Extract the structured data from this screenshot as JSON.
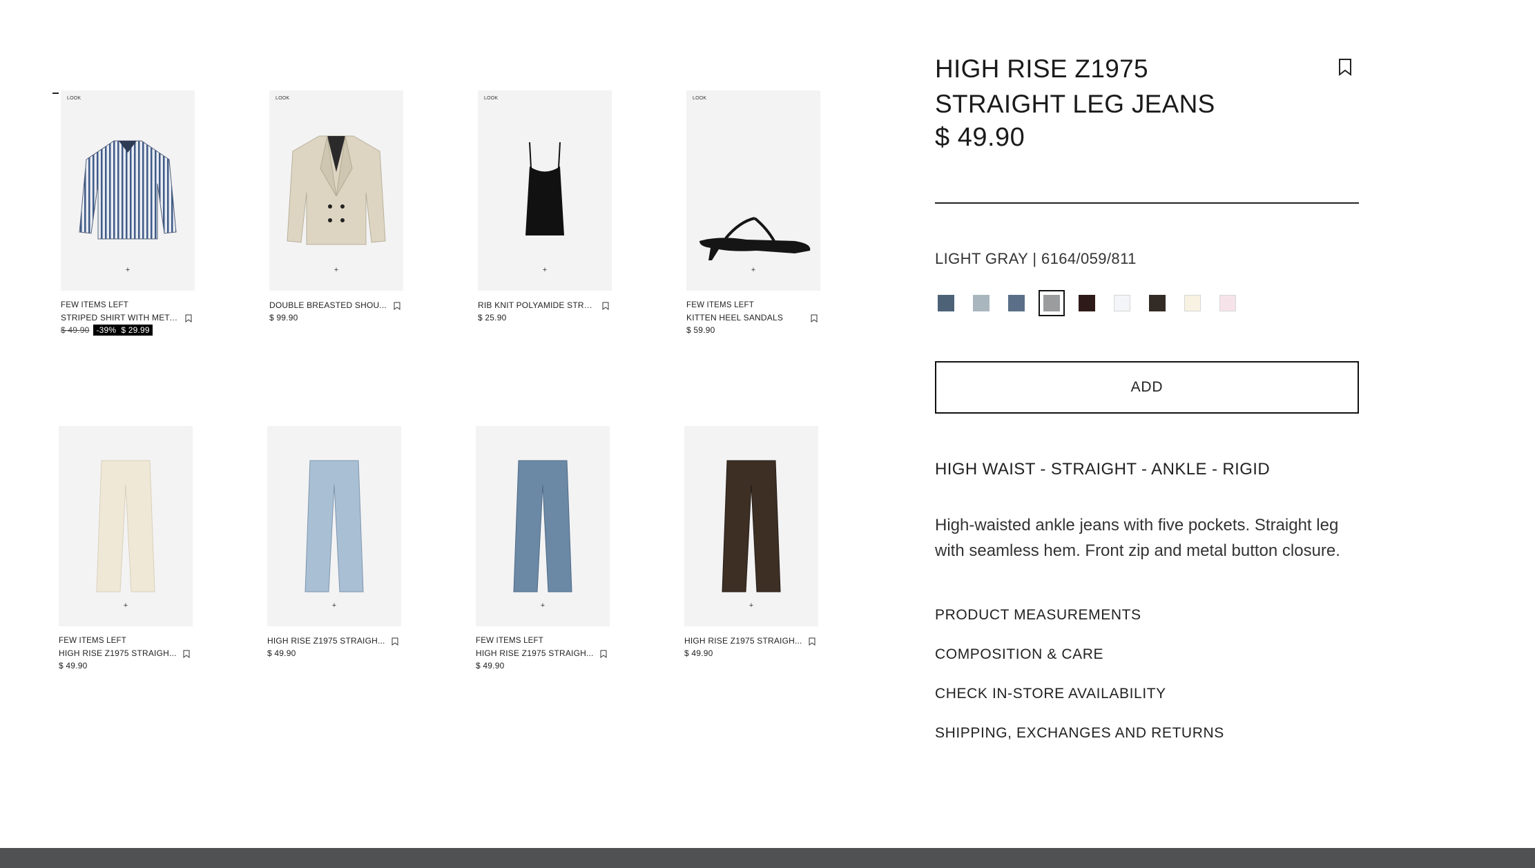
{
  "grid": {
    "row1": [
      {
        "look": "LOOK",
        "tag": "FEW ITEMS LEFT",
        "name": "STRIPED SHIRT WITH META...",
        "old_price": "$ 49.90",
        "discount": "-39%",
        "price": "$ 29.99"
      },
      {
        "look": "LOOK",
        "tag": "",
        "name": "DOUBLE BREASTED SHOU...",
        "price": "$ 99.90"
      },
      {
        "look": "LOOK",
        "tag": "",
        "name": "RIB KNIT POLYAMIDE STRA...",
        "price": "$ 25.90"
      },
      {
        "look": "LOOK",
        "tag": "FEW ITEMS LEFT",
        "name": "KITTEN HEEL SANDALS",
        "price": "$ 59.90"
      }
    ],
    "row2": [
      {
        "tag": "FEW ITEMS LEFT",
        "name": "HIGH RISE Z1975 STRAIGH...",
        "price": "$ 49.90"
      },
      {
        "tag": "",
        "name": "HIGH RISE Z1975 STRAIGH...",
        "price": "$ 49.90"
      },
      {
        "tag": "FEW ITEMS LEFT",
        "name": "HIGH RISE Z1975 STRAIGH...",
        "price": "$ 49.90"
      },
      {
        "tag": "",
        "name": "HIGH RISE Z1975 STRAIGH...",
        "price": "$ 49.90"
      }
    ],
    "plus": "+"
  },
  "product": {
    "title": "HIGH RISE Z1975 STRAIGHT LEG JEANS",
    "price": "$ 49.90",
    "color_ref": "LIGHT GRAY | 6164/059/811",
    "swatches": [
      "#4d6277",
      "#a9b6bd",
      "#5b7088",
      "#9b9c9e",
      "#2e1a18",
      "#f4f5f8",
      "#332b25",
      "#f8f2e2",
      "#f6e3ea"
    ],
    "selected_swatch": 3,
    "add_label": "ADD",
    "subtitle": "HIGH WAIST - STRAIGHT - ANKLE - RIGID",
    "description": "High-waisted ankle jeans with five pockets. Straight leg with seamless hem. Front zip and metal button closure.",
    "links": [
      "PRODUCT MEASUREMENTS",
      "COMPOSITION & CARE",
      "CHECK IN-STORE AVAILABILITY",
      "SHIPPING, EXCHANGES AND RETURNS"
    ]
  },
  "colors": {
    "footer": "#505153",
    "border": "#111111"
  }
}
